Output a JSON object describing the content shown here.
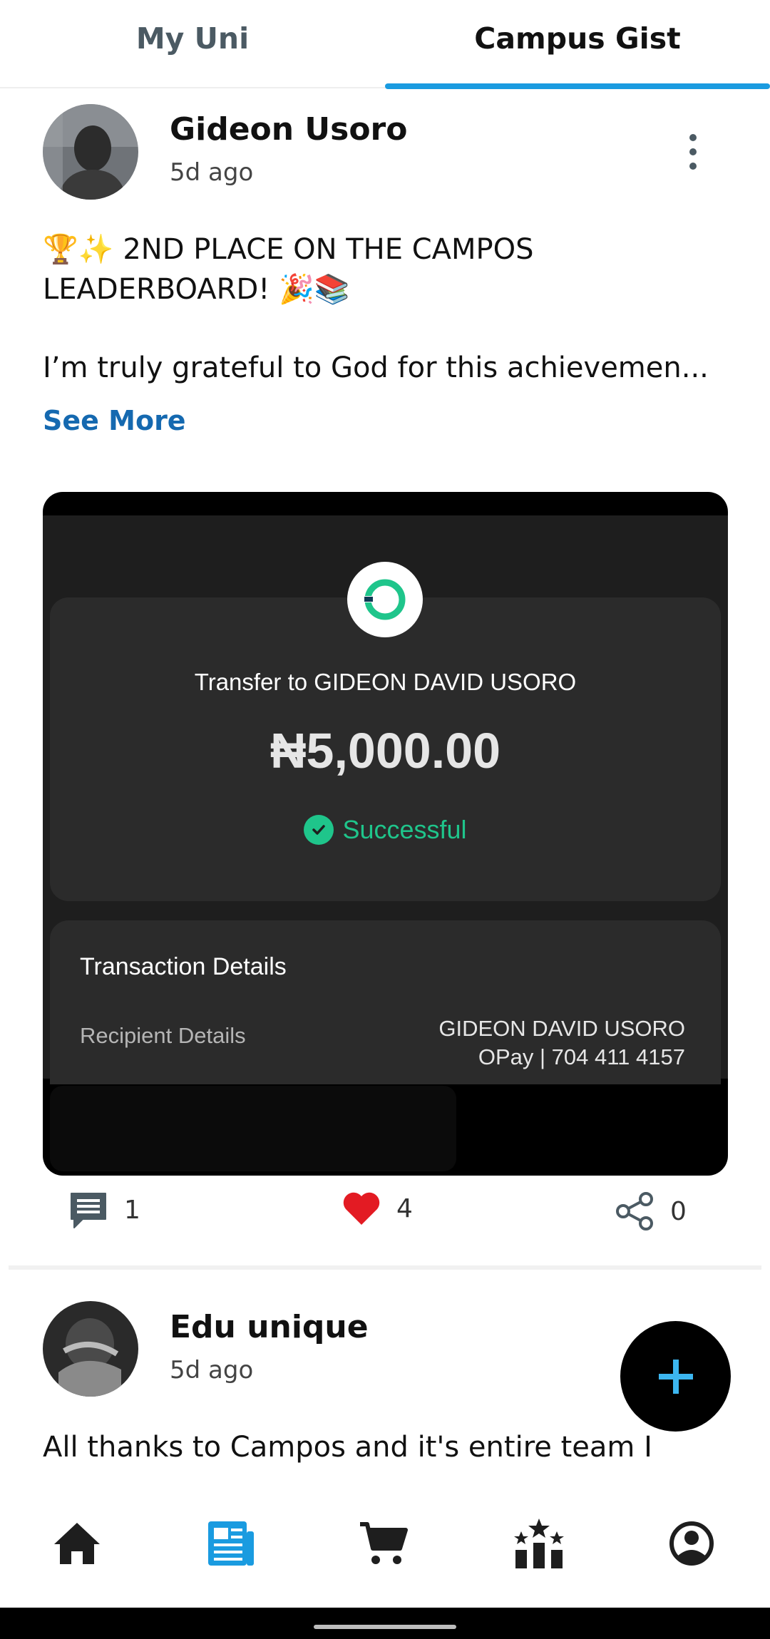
{
  "tabs": [
    {
      "label": "My Uni",
      "active": false
    },
    {
      "label": "Campus Gist",
      "active": true
    }
  ],
  "posts": [
    {
      "author": "Gideon Usoro",
      "time": "5d ago",
      "text_line1": "🏆✨ 2ND PLACE ON THE CAMPOS",
      "text_line2": "LEADERBOARD! 🎉📚",
      "text_line3": "I’m truly grateful to God for this achievemen...",
      "see_more": "See More",
      "receipt": {
        "title": "Transfer to GIDEON DAVID USORO",
        "amount": "₦5,000.00",
        "status": "Successful",
        "details_title": "Transaction Details",
        "recipient_label": "Recipient Details",
        "recipient_name": "GIDEON DAVID USORO",
        "recipient_account": "OPay | 704 411 4157"
      },
      "comments": "1",
      "likes": "4",
      "shares": "0"
    },
    {
      "author": "Edu unique",
      "time": "5d ago",
      "text_line1": "All thanks to Campos and it's entire team I"
    }
  ],
  "fab_icon": "plus-icon",
  "bottom_nav": [
    {
      "icon": "home-icon",
      "active": false
    },
    {
      "icon": "newspaper-icon",
      "active": true
    },
    {
      "icon": "cart-icon",
      "active": false
    },
    {
      "icon": "leaderboard-icon",
      "active": false
    },
    {
      "icon": "account-icon",
      "active": false
    }
  ],
  "colors": {
    "accent": "#1a9be0",
    "link": "#1569b0",
    "like": "#e31b23",
    "success": "#1fc58b"
  }
}
